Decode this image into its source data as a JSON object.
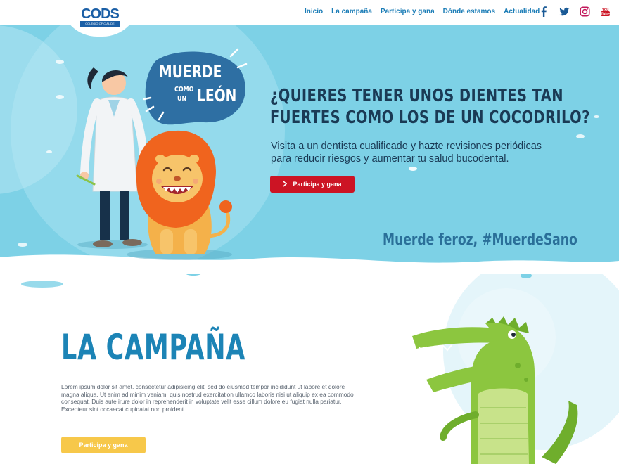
{
  "header": {
    "logo_text": "CODS",
    "logo_sub": "COLEGIO OFICIAL DE DENTISTAS DE SEVILLA",
    "nav": [
      "Inicio",
      "La campaña",
      "Participa y gana",
      "Dónde estamos",
      "Actualidad"
    ],
    "social_icons": [
      "facebook-icon",
      "twitter-icon",
      "instagram-icon",
      "youtube-icon"
    ]
  },
  "hero": {
    "badge_line1": "MUERDE",
    "badge_small1": "COMO",
    "badge_small2": "UN",
    "badge_line2": "LEÓN",
    "title_line1": "¿Quieres tener unos dientes tan",
    "title_line2": "fuertes como los de un cocodrilo?",
    "text": "Visita a un dentista cualificado y hazte revisiones periódicas para reducir riesgos y aumentar tu salud bucodental.",
    "button": "Participa y gana",
    "tagline": "Muerde feroz, #MuerdeSano"
  },
  "campaign": {
    "title": "La campaña",
    "text": "Lorem ipsum dolor sit amet, consectetur adipisicing elit, sed do eiusmod tempor incididunt ut labore et dolore magna aliqua. Ut enim ad minim veniam, quis nostrud exercitation ullamco laboris nisi ut aliquip ex ea commodo consequat. Duis aute irure dolor in reprehenderit in voluptate velit esse cillum dolore eu fugiat nulla pariatur. Excepteur sint occaecat cupidatat non proident ...",
    "button": "Participa y gana"
  },
  "colors": {
    "hero_bg": "#7dd1e6",
    "brand_blue": "#1b5fa6",
    "nav_blue": "#1a7cb6",
    "cta_red": "#cc1424",
    "cta_yellow": "#f7c84a",
    "lion_mane": "#f0641e",
    "croc_green": "#8cc63f"
  }
}
